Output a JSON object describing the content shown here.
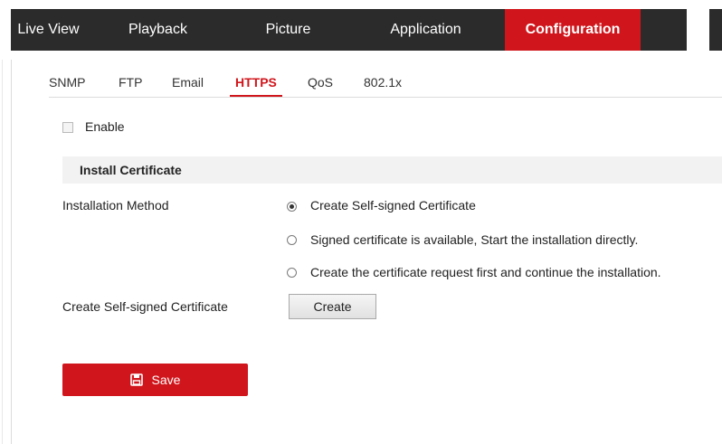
{
  "nav": {
    "items": [
      "Live View",
      "Playback",
      "Picture",
      "Application",
      "Configuration"
    ],
    "active": "Configuration"
  },
  "tabs": {
    "items": [
      "SNMP",
      "FTP",
      "Email",
      "HTTPS",
      "QoS",
      "802.1x"
    ],
    "active": "HTTPS"
  },
  "enable": {
    "label": "Enable",
    "checked": false
  },
  "section": {
    "title": "Install Certificate"
  },
  "install_method": {
    "label": "Installation Method",
    "options": [
      "Create Self-signed Certificate",
      "Signed certificate is available, Start the installation directly.",
      "Create the certificate request first and continue the installation."
    ],
    "selected": 0
  },
  "self_signed": {
    "label": "Create Self-signed Certificate",
    "button": "Create"
  },
  "save": {
    "label": "Save",
    "icon": "save-icon"
  },
  "colors": {
    "accent": "#d0161c",
    "nav_bg": "#2b2b2b",
    "section_bg": "#f2f2f2"
  }
}
